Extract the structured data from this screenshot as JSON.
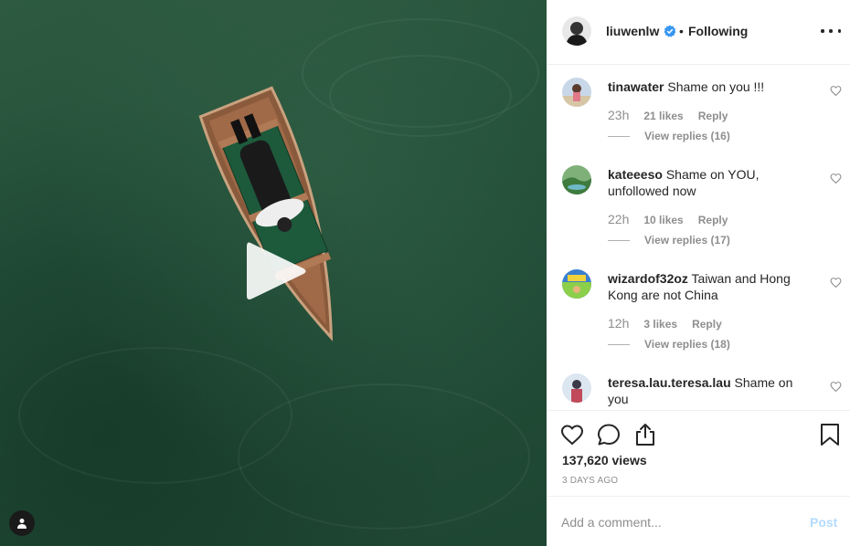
{
  "post": {
    "username": "liuwenlw",
    "verified_icon": "verified-badge-icon",
    "separator": "•",
    "follow_status": "Following",
    "more_icon": "more-options-icon",
    "views": "137,620 views",
    "time_ago": "3 DAYS AGO"
  },
  "video": {
    "play_icon": "play-icon",
    "user_tag_icon": "user-tag-icon"
  },
  "comments": [
    {
      "username": "tinawater",
      "text": "Shame on you !!!",
      "time": "23h",
      "likes": "21 likes",
      "reply": "Reply",
      "view_replies": "View replies (16)"
    },
    {
      "username": "kateeeso",
      "text": "Shame on YOU, unfollowed now",
      "time": "22h",
      "likes": "10 likes",
      "reply": "Reply",
      "view_replies": "View replies (17)"
    },
    {
      "username": "wizardof32oz",
      "text": "Taiwan and Hong Kong are not China",
      "time": "12h",
      "likes": "3 likes",
      "reply": "Reply",
      "view_replies": "View replies (18)"
    },
    {
      "username": "teresa.lau.teresa.lau",
      "text": "Shame on you"
    }
  ],
  "actions": {
    "like_icon": "heart-icon",
    "comment_icon": "comment-icon",
    "share_icon": "share-icon",
    "save_icon": "bookmark-icon"
  },
  "add_comment": {
    "placeholder": "Add a comment...",
    "post_label": "Post"
  },
  "colors": {
    "water": "#24503a",
    "link_disabled": "#b3dbff",
    "verified": "#3897f0",
    "muted": "#8e8e8e"
  }
}
